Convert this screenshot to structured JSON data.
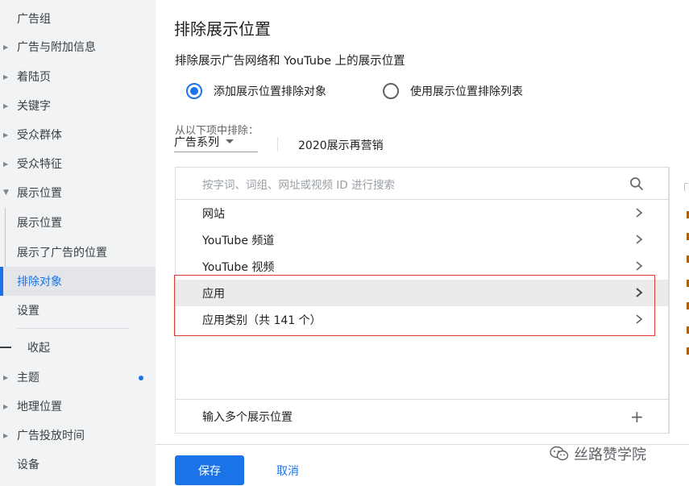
{
  "sidebar": {
    "items": [
      {
        "label": "广告组",
        "arrow": ""
      },
      {
        "label": "广告与附加信息",
        "arrow": "▶"
      },
      {
        "label": "着陆页",
        "arrow": "▶"
      },
      {
        "label": "关键字",
        "arrow": "▶"
      },
      {
        "label": "受众群体",
        "arrow": "▶"
      },
      {
        "label": "受众特征",
        "arrow": "▶"
      },
      {
        "label": "展示位置",
        "arrow": "▼"
      }
    ],
    "sub_items": [
      {
        "label": "展示位置"
      },
      {
        "label": "展示了广告的位置"
      },
      {
        "label": "排除对象"
      }
    ],
    "settings": "设置",
    "collapse": "收起",
    "more_items": [
      {
        "label": "主题",
        "arrow": "▶"
      },
      {
        "label": "地理位置",
        "arrow": "▶"
      },
      {
        "label": "广告投放时间",
        "arrow": "▶"
      },
      {
        "label": "设备",
        "arrow": ""
      }
    ]
  },
  "main": {
    "title": "排除展示位置",
    "section_title": "排除展示广告网络和 YouTube 上的展示位置",
    "radio_add": "添加展示位置排除对象",
    "radio_list": "使用展示位置排除列表",
    "from_label": "从以下项中排除：",
    "dropdown_value": "广告系列",
    "campaign_name": "2020展示再营销",
    "search_placeholder": "按字词、词组、网址或视频 ID 进行搜索",
    "rows": [
      {
        "label": "网站"
      },
      {
        "label": "YouTube 频道"
      },
      {
        "label": "YouTube 视频"
      },
      {
        "label": "应用"
      },
      {
        "label": "应用类别（共 141 个）"
      }
    ],
    "footer_label": "输入多个展示位置",
    "save": "保存",
    "cancel": "取消"
  },
  "watermark": "丝路赞学院",
  "colors": {
    "accent": "#1a73e8",
    "highlight_box": "#e53935",
    "sidebar_bg": "#f1f3f4"
  }
}
